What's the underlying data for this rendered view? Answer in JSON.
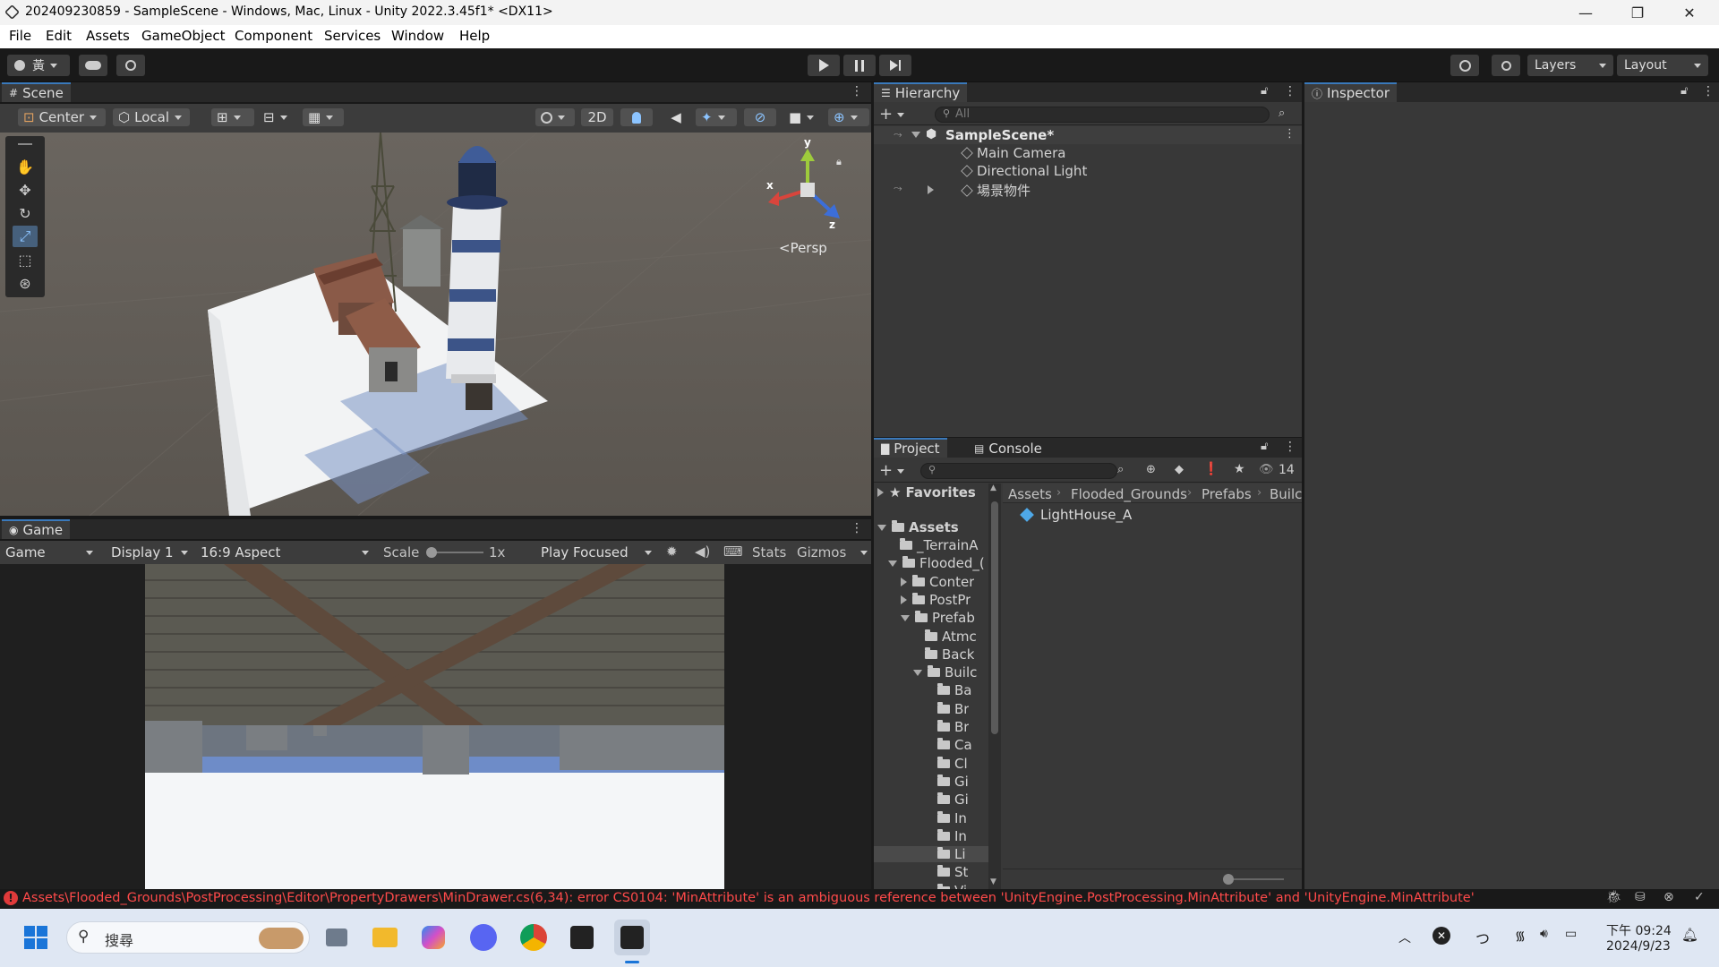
{
  "window": {
    "title": "202409230859 - SampleScene - Windows, Mac, Linux - Unity 2022.3.45f1* <DX11>",
    "minimize": "—",
    "maximize": "❐",
    "close": "✕"
  },
  "menu": [
    "File",
    "Edit",
    "Assets",
    "GameObject",
    "Component",
    "Services",
    "Window",
    "Help"
  ],
  "toolbar": {
    "account_label": "黃",
    "layers_label": "Layers",
    "layout_label": "Layout"
  },
  "scene": {
    "tab": "Scene",
    "pivot_mode": "Center",
    "pivot_space": "Local",
    "btn_2d": "2D",
    "persp_label": "<Persp",
    "gizmo_axes": {
      "x": "x",
      "y": "y",
      "z": "z"
    }
  },
  "game": {
    "tab": "Game",
    "view_mode": "Game",
    "display": "Display 1",
    "aspect": "16:9 Aspect",
    "scale_label": "Scale",
    "scale_value": "1x",
    "play_mode": "Play Focused",
    "stats": "Stats",
    "gizmos": "Gizmos"
  },
  "hierarchy": {
    "tab": "Hierarchy",
    "search_placeholder": "All",
    "scene_name": "SampleScene*",
    "items": [
      "Main Camera",
      "Directional Light",
      "場景物件"
    ]
  },
  "inspector": {
    "tab": "Inspector"
  },
  "project": {
    "tab_project": "Project",
    "tab_console": "Console",
    "hidden_count": "14",
    "favorites": "Favorites",
    "assets_root": "Assets",
    "tree": [
      {
        "label": "_TerrainA",
        "level": 1,
        "arrow": ""
      },
      {
        "label": "Flooded_(",
        "level": 1,
        "arrow": "down"
      },
      {
        "label": "Conter",
        "level": 2,
        "arrow": "right"
      },
      {
        "label": "PostPr",
        "level": 2,
        "arrow": "right"
      },
      {
        "label": "Prefab",
        "level": 2,
        "arrow": "down"
      },
      {
        "label": "Atmc",
        "level": 3,
        "arrow": ""
      },
      {
        "label": "Back",
        "level": 3,
        "arrow": ""
      },
      {
        "label": "Builc",
        "level": 3,
        "arrow": "down"
      },
      {
        "label": "Ba",
        "level": 4,
        "arrow": ""
      },
      {
        "label": "Br",
        "level": 4,
        "arrow": ""
      },
      {
        "label": "Br",
        "level": 4,
        "arrow": ""
      },
      {
        "label": "Ca",
        "level": 4,
        "arrow": ""
      },
      {
        "label": "Cl",
        "level": 4,
        "arrow": ""
      },
      {
        "label": "Gi",
        "level": 4,
        "arrow": ""
      },
      {
        "label": "Gi",
        "level": 4,
        "arrow": ""
      },
      {
        "label": "In",
        "level": 4,
        "arrow": ""
      },
      {
        "label": "In",
        "level": 4,
        "arrow": ""
      },
      {
        "label": "Li",
        "level": 4,
        "arrow": ""
      },
      {
        "label": "St",
        "level": 4,
        "arrow": ""
      },
      {
        "label": "Vi",
        "level": 4,
        "arrow": ""
      }
    ],
    "breadcrumb": [
      "Assets",
      "Flooded_Grounds",
      "Prefabs",
      "Builc"
    ],
    "files": [
      "LightHouse_A"
    ]
  },
  "status": {
    "error": "Assets\\Flooded_Grounds\\PostProcessing\\Editor\\PropertyDrawers\\MinDrawer.cs(6,34): error CS0104: 'MinAttribute' is an ambiguous reference between 'UnityEngine.PostProcessing.MinAttribute' and 'UnityEngine.MinAttribute'"
  },
  "taskbar": {
    "search": "搜尋",
    "time": "下午 09:24",
    "date": "2024/9/23"
  }
}
